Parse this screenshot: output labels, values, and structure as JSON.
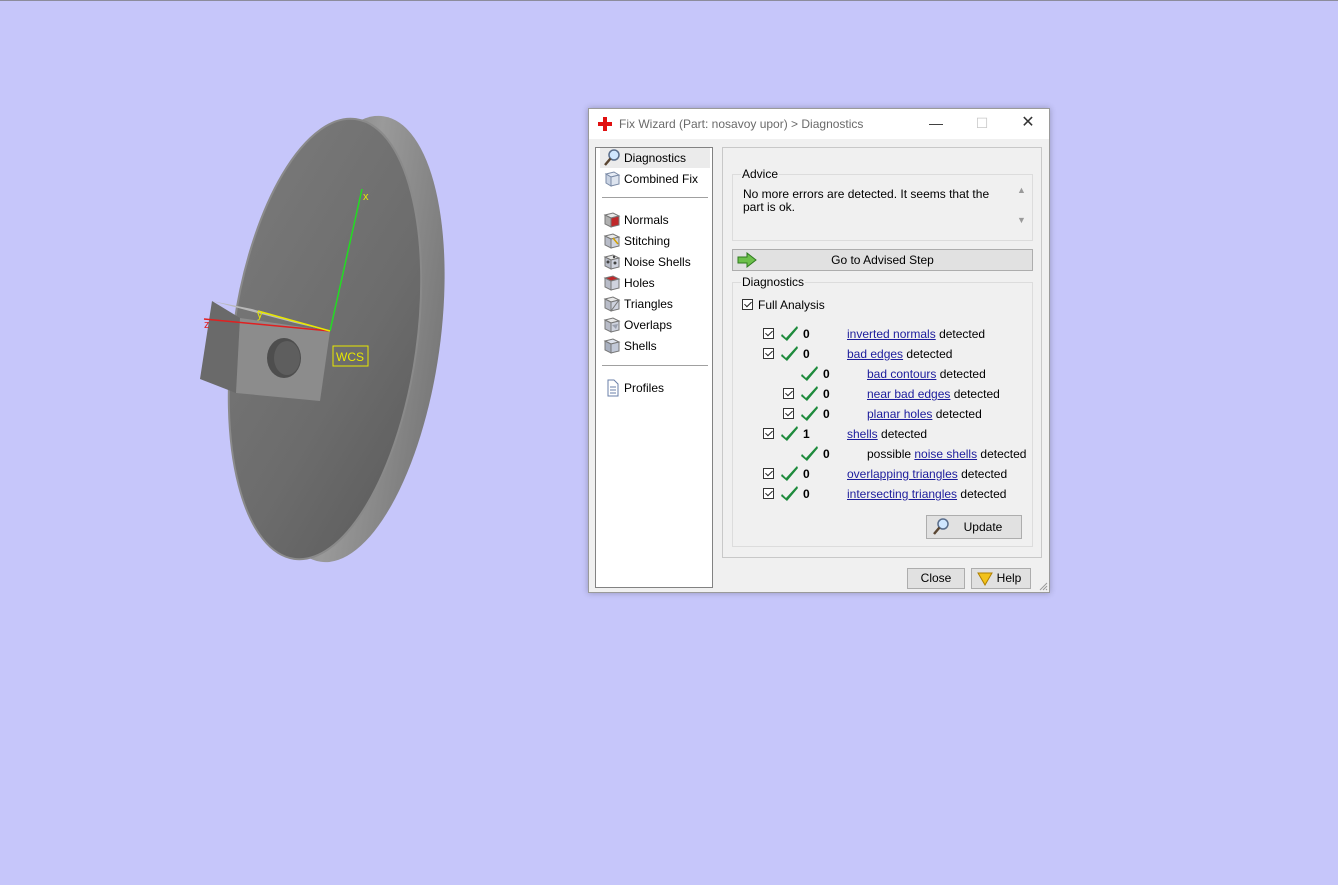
{
  "viewport": {
    "wcs_label": "WCS",
    "axis_x": "x",
    "axis_y": "y",
    "axis_z": "z"
  },
  "dialog": {
    "title": "Fix Wizard (Part: nosavoy upor) > Diagnostics",
    "minimize": "—",
    "maximize": "☐",
    "close_glyph": "✕"
  },
  "nav": {
    "diagnostics": "Diagnostics",
    "combined_fix": "Combined Fix",
    "normals": "Normals",
    "stitching": "Stitching",
    "noise_shells": "Noise Shells",
    "holes": "Holes",
    "triangles": "Triangles",
    "overlaps": "Overlaps",
    "shells": "Shells",
    "profiles": "Profiles"
  },
  "advice": {
    "label": "Advice",
    "text": "No more errors are detected. It seems that the part is ok.",
    "go_button": "Go to Advised Step"
  },
  "diagnostics": {
    "label": "Diagnostics",
    "full_analysis": "Full Analysis",
    "detected": "detected",
    "possible": "possible",
    "rows": {
      "inverted_normals": {
        "count": "0",
        "link": "inverted normals"
      },
      "bad_edges": {
        "count": "0",
        "link": "bad edges"
      },
      "bad_contours": {
        "count": "0",
        "link": "bad contours"
      },
      "near_bad_edges": {
        "count": "0",
        "link": "near bad edges"
      },
      "planar_holes": {
        "count": "0",
        "link": "planar holes"
      },
      "shells": {
        "count": "1",
        "link": "shells"
      },
      "noise_shells": {
        "count": "0",
        "link": "noise shells"
      },
      "overlapping_triangles": {
        "count": "0",
        "link": "overlapping triangles"
      },
      "intersecting_triangles": {
        "count": "0",
        "link": "intersecting triangles"
      }
    },
    "update_button": "Update"
  },
  "footer": {
    "close": "Close",
    "help": "Help"
  },
  "colors": {
    "background": "#c6c6fa",
    "ok_tick": "#1e8a3c",
    "link": "#1c1c9c",
    "wcs": "#e8e800"
  }
}
